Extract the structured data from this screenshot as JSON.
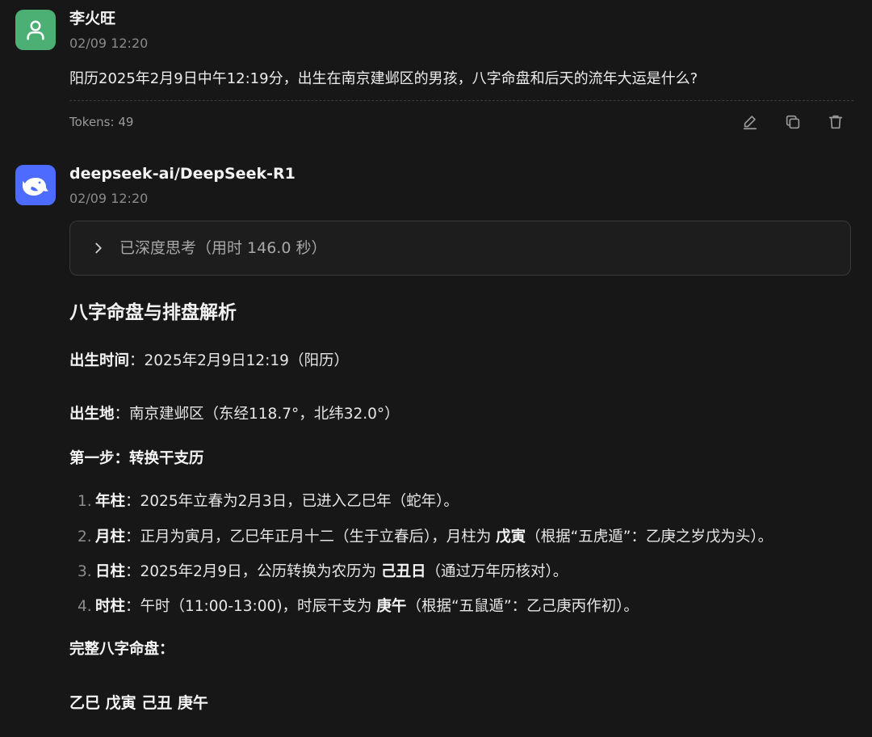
{
  "user_message": {
    "name": "李火旺",
    "time": "02/09 12:20",
    "text": "阳历2025年2月9日中午12:19分，出生在南京建邺区的男孩，八字命盘和后天的流年大运是什么?",
    "tokens": "Tokens: 49",
    "actions": [
      "edit-icon",
      "copy-icon",
      "trash-icon"
    ]
  },
  "ai_message": {
    "name": "deepseek-ai/DeepSeek-R1",
    "time": "02/09 12:20",
    "thinking_label": "已深度思考（用时 146.0 秒）",
    "title": "八字命盘与排盘解析",
    "birth_time_label": "出生时间",
    "birth_time_value": "：2025年2月9日12:19（阳历）",
    "birth_place_label": "出生地",
    "birth_place_value": "：南京建邺区（东经118.7°，北纬32.0°）",
    "step1": "第一步：转换干支历",
    "list": [
      {
        "num": "1.",
        "label": "年柱",
        "text": "：2025年立春为2月3日，已进入乙巳年（蛇年）。"
      },
      {
        "num": "2.",
        "label": "月柱",
        "pre": "：正月为寅月，乙巳年正月十二（生于立春后），月柱为 ",
        "bold": "戊寅",
        "post": "（根据“五虎遁”：乙庚之岁戊为头）。"
      },
      {
        "num": "3.",
        "label": "日柱",
        "pre": "：2025年2月9日，公历转换为农历为 ",
        "bold": "己丑日",
        "post": "（通过万年历核对）。"
      },
      {
        "num": "4.",
        "label": "时柱",
        "pre": "：午时（11:00-13:00)，时辰干支为 ",
        "bold": "庚午",
        "post": "（根据“五鼠遁”：乙己庚丙作初）。"
      }
    ],
    "full_label": "完整八字命盘：",
    "pillars": "乙巳 戊寅 己丑 庚午"
  },
  "colors": {
    "background": "#171717",
    "user_avatar": "#4caf74",
    "ai_avatar": "#4d6bfe"
  }
}
